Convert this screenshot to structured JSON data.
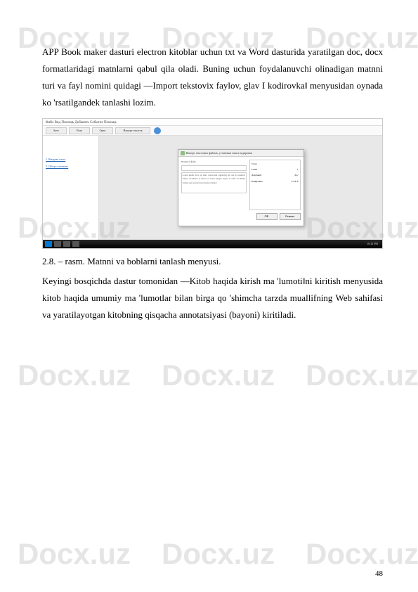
{
  "watermark": "Docx.uz",
  "paragraphs": {
    "p1": "APP Book maker dasturi electron kitoblar uchun txt va Word dasturida yaratilgan doc, docx formatlaridagi matnlarni qabul qila oladi. Buning uchun foydalanuvchi olinadigan matnni turi va fayl nomini quidagi ―Import tekstovix faylov, glav I kodirovka‖ menyusidan oynada ko 'rsatilgandek tanlashi lozim.",
    "caption": "2.8.    – rasm. Matnni va boblarni tanlash menyusi.",
    "p2": "Keyingi bosqichda dastur tomonidan ―Kitob haqida kirish ma 'lumoti‖ni kiritish menyusida kitob haqida umumiy ma 'lumotlar bilan birga qo 'shimcha tarzda muallifning Web sahifasi va yaratilayotgan kitobning qisqacha annotatsiyasi (bayoni) kiritiladi."
  },
  "screenshot": {
    "menu": "Файл  Вид  Помощь  Добавить  Событие  Помощь",
    "toolbar": {
      "b1": "Save",
      "b2": "Print",
      "b3": "Open",
      "b4": "Импорт текстов"
    },
    "sidebar": {
      "link1": "1. Вводная часть",
      "link2": "2. Обзор основных"
    },
    "dialog": {
      "title": "Импорт текстовых файлов, установки глав и кодировки",
      "left_label": "Укажите файл",
      "right_title": "Типы",
      "row1": "Глава",
      "row2": "Документ",
      "row3": "Кодировка",
      "val1": "1",
      "val2": "doc",
      "val3": "UTF-8",
      "ok": "OK",
      "cancel": "Отмена"
    },
    "taskbar_time": "10:32 PM"
  },
  "page_number": "48"
}
